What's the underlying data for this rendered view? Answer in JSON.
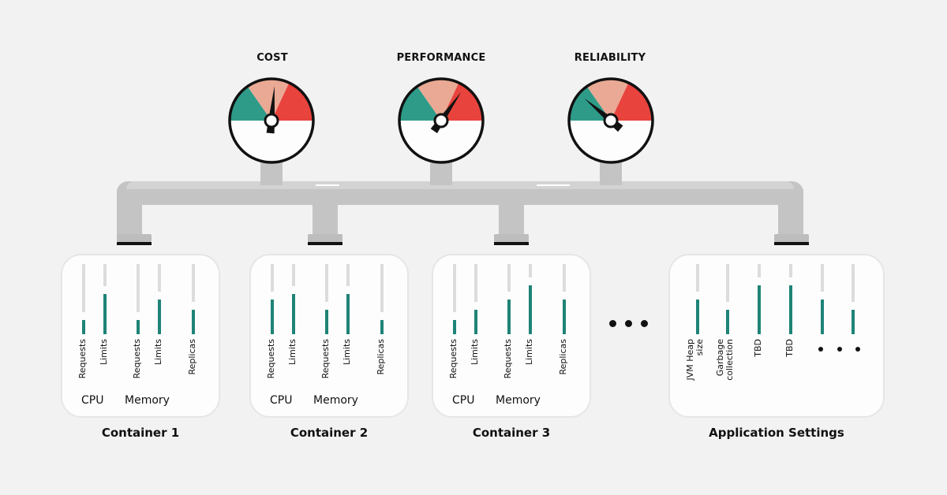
{
  "gauges": [
    {
      "title": "COST",
      "needle_deg": 5
    },
    {
      "title": "PERFORMANCE",
      "needle_deg": 35
    },
    {
      "title": "RELIABILITY",
      "needle_deg": -50
    }
  ],
  "gauge_colors": {
    "good": "#2e9b89",
    "mid": "#eaa994",
    "bad": "#e8433d"
  },
  "bar_color": "#1f8377",
  "containers": [
    {
      "title": "Container 1",
      "groups": [
        "CPU",
        "Memory"
      ],
      "bars": [
        {
          "label": "Requests",
          "level": 0.2
        },
        {
          "label": "Limits",
          "level": 0.57
        },
        {
          "label": "Requests",
          "level": 0.2
        },
        {
          "label": "Limits",
          "level": 0.49
        },
        {
          "label": "Replicas",
          "level": 0.35
        }
      ]
    },
    {
      "title": "Container 2",
      "groups": [
        "CPU",
        "Memory"
      ],
      "bars": [
        {
          "label": "Requests",
          "level": 0.49
        },
        {
          "label": "Limits",
          "level": 0.57
        },
        {
          "label": "Requests",
          "level": 0.35
        },
        {
          "label": "Limits",
          "level": 0.57
        },
        {
          "label": "Replicas",
          "level": 0.2
        }
      ]
    },
    {
      "title": "Container 3",
      "groups": [
        "CPU",
        "Memory"
      ],
      "bars": [
        {
          "label": "Requests",
          "level": 0.2
        },
        {
          "label": "Limits",
          "level": 0.35
        },
        {
          "label": "Requests",
          "level": 0.49
        },
        {
          "label": "Limits",
          "level": 0.7
        },
        {
          "label": "Replicas",
          "level": 0.49
        }
      ]
    }
  ],
  "app_settings": {
    "title": "Application Settings",
    "bars": [
      {
        "label_line1": "JVM Heap",
        "label_line2": "size",
        "level": 0.49
      },
      {
        "label_line1": "Garbage",
        "label_line2": "collection",
        "level": 0.35
      },
      {
        "label_line1": "TBD",
        "label_line2": "",
        "level": 0.7
      },
      {
        "label_line1": "TBD",
        "label_line2": "",
        "level": 0.7
      },
      {
        "label_line1": "",
        "label_line2": "",
        "level": 0.49
      },
      {
        "label_line1": "",
        "label_line2": "",
        "level": 0.35
      }
    ]
  },
  "ellipsis": "more-containers"
}
